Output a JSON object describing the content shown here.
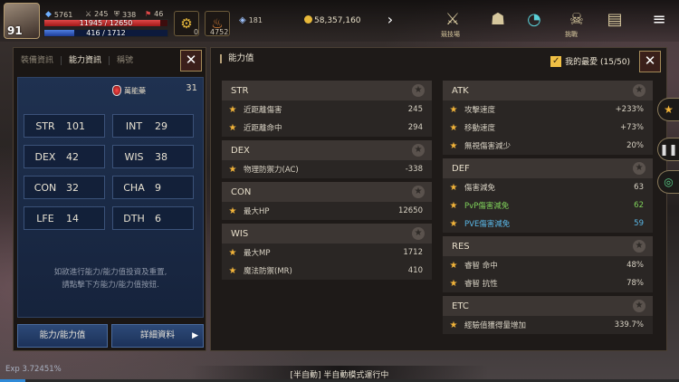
{
  "hud": {
    "level": "91",
    "hp_text": "11945 / 12650",
    "hp_fraction": 0.944,
    "mp_text": "416 / 1712",
    "mp_fraction": 0.243,
    "top_values": [
      "245",
      "338",
      "46"
    ],
    "power_text": "5761",
    "slot1_count": "0",
    "slot2_count": "4752",
    "gem_count": "181",
    "gold": "58,357,160",
    "icon_labels": {
      "menu1": "競技場",
      "menu2": "挑戰"
    }
  },
  "left": {
    "tabs": [
      "裝備資訊",
      "能力資訊",
      "稱號"
    ],
    "active_tab": 1,
    "potion_label": "萬能藥",
    "potion_count": "31",
    "stats": [
      {
        "k": "STR",
        "v": "101"
      },
      {
        "k": "INT",
        "v": "29"
      },
      {
        "k": "DEX",
        "v": "42"
      },
      {
        "k": "WIS",
        "v": "38"
      },
      {
        "k": "CON",
        "v": "32"
      },
      {
        "k": "CHA",
        "v": "9"
      },
      {
        "k": "LFE",
        "v": "14"
      },
      {
        "k": "DTH",
        "v": "6"
      }
    ],
    "note_line1": "如欲進行能力/能力值投資及重置,",
    "note_line2": "請點擊下方能力/能力值按鈕.",
    "btn_ability": "能力/能力值",
    "btn_detail": "詳細資料",
    "close": "✕"
  },
  "right": {
    "title": "能力值",
    "fav_label": "我的最愛 (15/50)",
    "close": "✕",
    "left_groups": [
      {
        "name": "STR",
        "rows": [
          {
            "label": "近距離傷害",
            "value": "245"
          },
          {
            "label": "近距離命中",
            "value": "294"
          }
        ]
      },
      {
        "name": "DEX",
        "rows": [
          {
            "label": "物理防禦力(AC)",
            "value": "-338"
          }
        ]
      },
      {
        "name": "CON",
        "rows": [
          {
            "label": "最大HP",
            "value": "12650"
          }
        ]
      },
      {
        "name": "WIS",
        "rows": [
          {
            "label": "最大MP",
            "value": "1712"
          },
          {
            "label": "魔法防禦(MR)",
            "value": "410"
          }
        ]
      }
    ],
    "right_groups": [
      {
        "name": "ATK",
        "rows": [
          {
            "label": "攻擊速度",
            "value": "+233%"
          },
          {
            "label": "移動速度",
            "value": "+73%"
          },
          {
            "label": "無視傷害減少",
            "value": "20%"
          }
        ]
      },
      {
        "name": "DEF",
        "rows": [
          {
            "label": "傷害減免",
            "value": "63"
          },
          {
            "label": "PvP傷害減免",
            "value": "62",
            "color": "green"
          },
          {
            "label": "PVE傷害減免",
            "value": "59",
            "color": "blue"
          }
        ]
      },
      {
        "name": "RES",
        "rows": [
          {
            "label": "睿智 命中",
            "value": "48%"
          },
          {
            "label": "睿智 抗性",
            "value": "78%"
          }
        ]
      },
      {
        "name": "ETC",
        "rows": [
          {
            "label": "經驗值獲得量增加",
            "value": "339.7%"
          }
        ]
      }
    ]
  },
  "footer": {
    "exp_text": "Exp 3.72451%",
    "exp_fraction": 0.0372,
    "auto_text": "[半自動] 半自動模式運行中"
  },
  "colors": {
    "accent_gold": "#f2b43a",
    "green": "#7fd15a",
    "blue": "#5ab8e8",
    "hp": "#d83a3a",
    "mp": "#3a66c8"
  }
}
